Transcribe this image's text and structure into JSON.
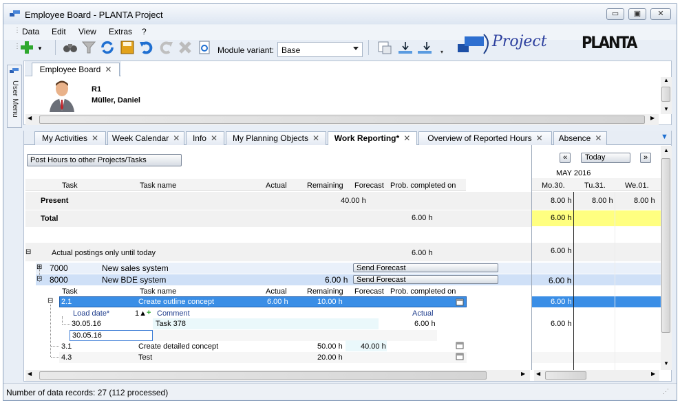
{
  "window": {
    "title": "Employee Board - PLANTA Project"
  },
  "menu": {
    "items": [
      "Data",
      "Edit",
      "View",
      "Extras",
      "?"
    ]
  },
  "toolbar": {
    "module_variant_label": "Module variant:",
    "module_variant_value": "Base",
    "logo_project": "Project",
    "logo_planta": "PLANTA"
  },
  "user_menu": {
    "label": "User Menu"
  },
  "doc_tab": {
    "label": "Employee Board"
  },
  "employee": {
    "id": "R1",
    "name": "Müller, Daniel"
  },
  "tabs": [
    {
      "label": "My Activities",
      "active": false
    },
    {
      "label": "Week Calendar",
      "active": false
    },
    {
      "label": "Info",
      "active": false
    },
    {
      "label": "My Planning Objects",
      "active": false
    },
    {
      "label": "Work Reporting*",
      "active": true
    },
    {
      "label": "Overview of Reported Hours",
      "active": false
    },
    {
      "label": "Absence",
      "active": false
    }
  ],
  "post_hours_button": "Post Hours to other Projects/Tasks",
  "columns": {
    "task": "Task",
    "task_name": "Task name",
    "actual": "Actual",
    "remaining": "Remaining",
    "forecast": "Forecast",
    "prob_completed": "Prob. completed on"
  },
  "rows": {
    "present_label": "Present",
    "present_remaining": "40.00 h",
    "total_label": "Total",
    "total_prob": "6.00 h",
    "actual_postings_label": "Actual postings only until today",
    "actual_postings_prob": "6.00 h"
  },
  "projects": [
    {
      "id": "7000",
      "name": "New sales system",
      "remaining": "",
      "button": "Send Forecast"
    },
    {
      "id": "8000",
      "name": "New BDE system",
      "remaining": "6.00 h",
      "button": "Send Forecast"
    }
  ],
  "sub_columns": {
    "task": "Task",
    "task_name": "Task name",
    "actual": "Actual",
    "remaining": "Remaining",
    "forecast": "Forecast",
    "prob_completed": "Prob. completed on"
  },
  "tasks": [
    {
      "id": "2.1",
      "name": "Create outline concept",
      "actual": "6.00 h",
      "remaining": "10.00 h",
      "forecast": "",
      "selected": true
    },
    {
      "id": "3.1",
      "name": "Create detailed concept",
      "actual": "",
      "remaining": "50.00 h",
      "forecast": "40.00 h",
      "selected": false
    },
    {
      "id": "4.3",
      "name": "Test",
      "actual": "",
      "remaining": "20.00 h",
      "forecast": "",
      "selected": false
    }
  ],
  "postings_header": {
    "load_date": "Load date*",
    "sort_indicator": "1▲",
    "comment": "Comment",
    "actual": "Actual"
  },
  "postings": [
    {
      "date": "30.05.16",
      "comment": "Task 378",
      "actual": "6.00 h"
    }
  ],
  "new_posting_date": "30.05.16",
  "calendar": {
    "prev": "«",
    "today": "Today",
    "next": "»",
    "month": "MAY 2016",
    "days": [
      "Mo.30.",
      "Tu.31.",
      "We.01."
    ],
    "present": [
      "8.00 h",
      "8.00 h",
      "8.00 h"
    ],
    "total_mo": "6.00 h",
    "actual_postings_mo": "6.00 h",
    "bde_mo": "6.00 h",
    "task21_mo": "6.00 h",
    "posting_mo": "6.00 h"
  },
  "status": {
    "text": "Number of data records: 27 (112 processed)"
  },
  "colors": {
    "accent_selected": "#3a8ee6",
    "project_row": "#cfe0f7",
    "highlight_yellow": "#ffff80"
  }
}
